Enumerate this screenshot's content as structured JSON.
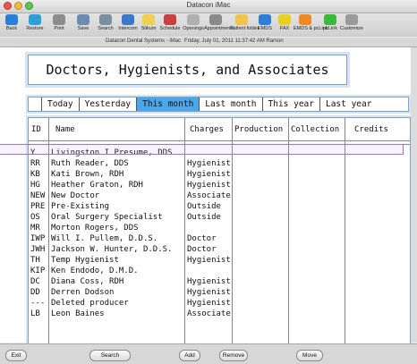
{
  "window": {
    "title": "Datacon iMac"
  },
  "toolbar": {
    "items": [
      {
        "label": "Back",
        "color": "#2b7fd6"
      },
      {
        "label": "Restore",
        "color": "#2b9fd6"
      },
      {
        "label": "Print",
        "color": "#8c8c8c"
      },
      {
        "label": "Save",
        "color": "#6a8db0"
      },
      {
        "label": "Search",
        "color": "#7a8fa0"
      },
      {
        "label": "Intercom",
        "color": "#3b78c8"
      },
      {
        "label": "Stikum",
        "color": "#f0d050"
      },
      {
        "label": "Schedule",
        "color": "#c84040"
      },
      {
        "label": "Openings",
        "color": "#b0b0b0"
      },
      {
        "label": "Appointments",
        "color": "#8a8a8a"
      },
      {
        "label": "Patient folder",
        "color": "#f2c44a"
      },
      {
        "label": "EMDS",
        "color": "#2b7fd6"
      },
      {
        "label": "FAX",
        "color": "#e8d020"
      },
      {
        "label": "EMDS & pcLink",
        "color": "#f08a20"
      },
      {
        "label": "pcLink",
        "color": "#3cb83c"
      },
      {
        "label": "Customize",
        "color": "#9a9a9a"
      }
    ]
  },
  "status": {
    "app": "Datacon Dental Systems - iMac",
    "datetime": "Friday, July 01, 2011  11:37:42 AM  Ramon"
  },
  "header": {
    "title": "Doctors, Hygienists, and Associates"
  },
  "tabs": [
    {
      "label": "Today",
      "active": false
    },
    {
      "label": "Yesterday",
      "active": false
    },
    {
      "label": "This month",
      "active": true
    },
    {
      "label": "Last month",
      "active": false
    },
    {
      "label": "This year",
      "active": false
    },
    {
      "label": "Last year",
      "active": false
    }
  ],
  "table": {
    "columns": [
      "ID",
      "Name",
      "Charges",
      "Production",
      "Collection",
      "Credits"
    ],
    "rows": [
      {
        "id": "Y",
        "name": "Livingston I Presume, DDS",
        "type": "",
        "selected": true
      },
      {
        "id": "RR",
        "name": "Ruth Reader, DDS",
        "type": "Hygienist"
      },
      {
        "id": "KB",
        "name": "Kati Brown, RDH",
        "type": "Hygienist"
      },
      {
        "id": "HG",
        "name": "Heather Graton, RDH",
        "type": "Hygienist"
      },
      {
        "id": "NEW",
        "name": "New Doctor",
        "type": "Associate"
      },
      {
        "id": "PRE",
        "name": "Pre-Existing",
        "type": "Outside"
      },
      {
        "id": "OS",
        "name": "Oral Surgery Specialist",
        "type": "Outside"
      },
      {
        "id": "MR",
        "name": "Morton Rogers, DDS",
        "type": ""
      },
      {
        "id": "IWP",
        "name": "Will I. Pullem, D.D.S.",
        "type": "Doctor"
      },
      {
        "id": "JWH",
        "name": "Jackson W. Hunter, D.D.S.",
        "type": "Doctor"
      },
      {
        "id": "TH",
        "name": "Temp Hygienist",
        "type": "Hygienist"
      },
      {
        "id": "KIP",
        "name": "Ken Endodo, D.M.D.",
        "type": ""
      },
      {
        "id": "DC",
        "name": "Diana Coss, RDH",
        "type": "Hygienist"
      },
      {
        "id": "DD",
        "name": "Derren Dodson",
        "type": "Hygienist"
      },
      {
        "id": "---",
        "name": "Deleted producer",
        "type": "Hygienist"
      },
      {
        "id": "LB",
        "name": "Leon Baines",
        "type": "Associate"
      }
    ]
  },
  "bottom": {
    "buttons": [
      "Exit",
      "Search",
      "Add",
      "Remove",
      "Move"
    ]
  }
}
